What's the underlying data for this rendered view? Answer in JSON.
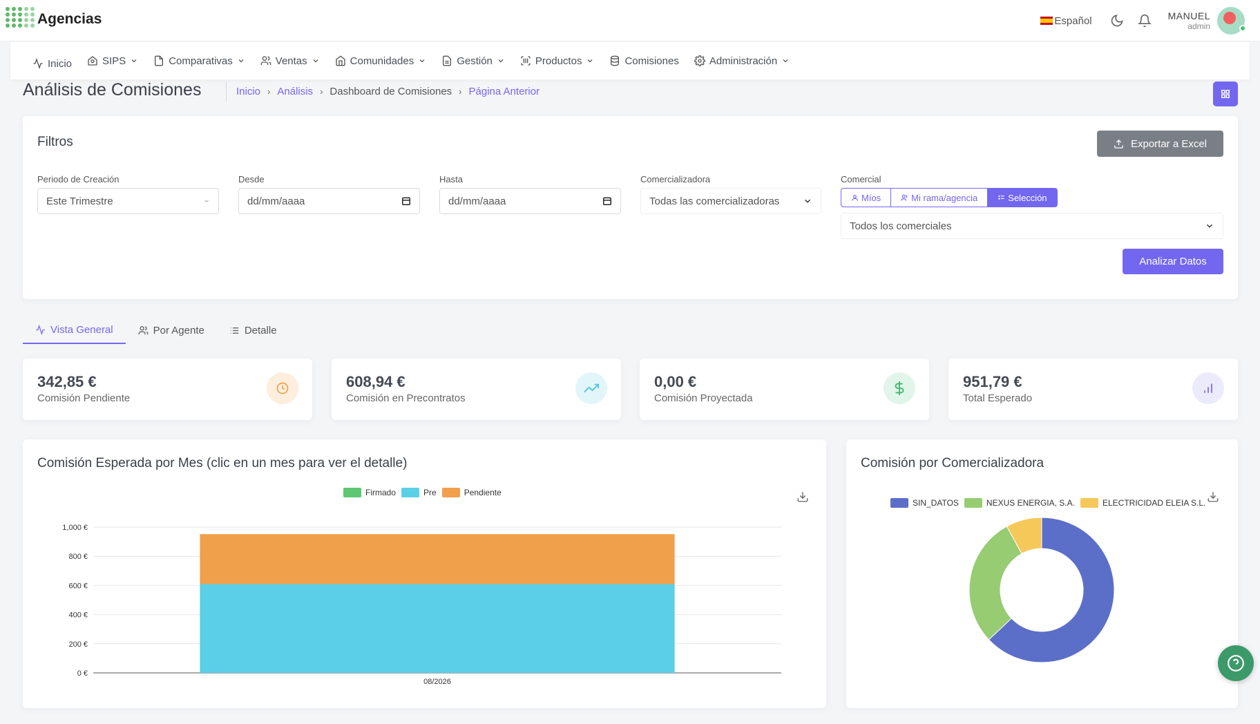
{
  "app": {
    "title": "Agencias"
  },
  "topbar": {
    "language": "Español",
    "user_name": "MANUEL",
    "user_role": "admin",
    "icons": [
      "moon-icon",
      "bell-icon"
    ]
  },
  "nav": {
    "items": [
      {
        "label": "Inicio",
        "icon": "activity-icon"
      },
      {
        "label": "SIPS",
        "icon": "building-icon"
      },
      {
        "label": "Comparativas",
        "icon": "document-icon"
      },
      {
        "label": "Ventas",
        "icon": "users-icon"
      },
      {
        "label": "Comunidades",
        "icon": "home-icon"
      },
      {
        "label": "Gestión",
        "icon": "file-icon"
      },
      {
        "label": "Productos",
        "icon": "barcode-icon"
      },
      {
        "label": "Comisiones",
        "icon": "database-icon"
      },
      {
        "label": "Administración",
        "icon": "gear-icon"
      }
    ]
  },
  "page": {
    "title": "Análisis de Comisiones",
    "breadcrumb": [
      "Inicio",
      "Análisis",
      "Dashboard de Comisiones",
      "Página Anterior"
    ]
  },
  "filters": {
    "title": "Filtros",
    "export_label": "Exportar a Excel",
    "periodo_label": "Periodo de Creación",
    "periodo_value": "Este Trimestre",
    "desde_label": "Desde",
    "desde_placeholder": "dd/mm/aaaa",
    "hasta_label": "Hasta",
    "hasta_placeholder": "dd/mm/aaaa",
    "comercializadora_label": "Comercializadora",
    "comercializadora_value": "Todas las comercializadoras",
    "comercial_label": "Comercial",
    "segments": [
      "Míos",
      "Mi rama/agencia",
      "Selección"
    ],
    "active_segment": "Selección",
    "comerciales_value": "Todos los comerciales",
    "analyze_label": "Analizar Datos"
  },
  "tabs": [
    "Vista General",
    "Por Agente",
    "Detalle"
  ],
  "stats": [
    {
      "value": "342,85 €",
      "label": "Comisión Pendiente",
      "icon": "clock-icon",
      "color": "#f0a04b",
      "bg": "#fdeedd"
    },
    {
      "value": "608,94 €",
      "label": "Comisión en Precontratos",
      "icon": "trending-up-icon",
      "color": "#4cc6e0",
      "bg": "#e2f6fa"
    },
    {
      "value": "0,00 €",
      "label": "Comisión Proyectada",
      "icon": "dollar-icon",
      "color": "#3fb66e",
      "bg": "#e2f5ea"
    },
    {
      "value": "951,79 €",
      "label": "Total Esperado",
      "icon": "bar-chart-icon",
      "color": "#7367f0",
      "bg": "#ecebfc"
    }
  ],
  "chart_data": [
    {
      "type": "bar",
      "stacked": true,
      "title": "Comisión Esperada por Mes (clic en un mes para ver el detalle)",
      "categories": [
        "08/2026"
      ],
      "series": [
        {
          "name": "Firmado",
          "values": [
            0
          ],
          "color": "#5ec774"
        },
        {
          "name": "Pre",
          "values": [
            608.94
          ],
          "color": "#5bcfe6"
        },
        {
          "name": "Pendiente",
          "values": [
            342.85
          ],
          "color": "#f0a04b"
        }
      ],
      "ylim": [
        0,
        1000
      ],
      "yticks": [
        0,
        200,
        400,
        600,
        800,
        1000
      ],
      "ytick_labels": [
        "0 €",
        "200 €",
        "400 €",
        "600 €",
        "800 €",
        "1,000 €"
      ],
      "legend": "top",
      "grid": true
    },
    {
      "type": "pie",
      "donut": true,
      "title": "Comisión por Comercializadora",
      "labels": [
        "SIN_DATOS",
        "NEXUS ENERGIA, S.A.",
        "ELECTRICIDAD ELEIA S.L."
      ],
      "values": [
        0.63,
        0.29,
        0.08
      ],
      "colors": [
        "#5b6fc8",
        "#97cc72",
        "#f5c85a"
      ],
      "legend": "top"
    }
  ]
}
